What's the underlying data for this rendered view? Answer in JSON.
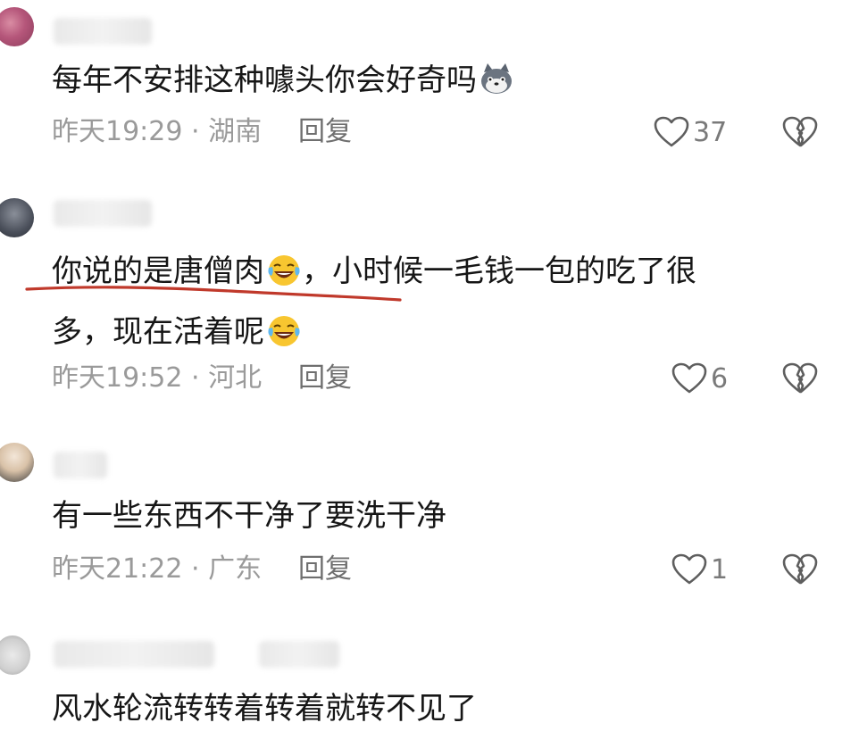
{
  "comments": [
    {
      "text_before": "每年不安排这种噱头你会好奇吗",
      "text_after": "",
      "emoji": "wolf-emoji",
      "time": "昨天19:29",
      "sep": "·",
      "location": "湖南",
      "reply": "回复",
      "likes": "37"
    },
    {
      "line1_highlight": "你说的是唐僧肉",
      "line1_rest": "，小时候一毛钱一包的吃了很",
      "line2": "多，现在活着呢",
      "emoji": "laughing-tears-emoji",
      "time": "昨天19:52",
      "sep": "·",
      "location": "河北",
      "reply": "回复",
      "likes": "6"
    },
    {
      "text_before": "有一些东西不干净了要洗干净",
      "time": "昨天21:22",
      "sep": "·",
      "location": "广东",
      "reply": "回复",
      "likes": "1"
    },
    {
      "text_before": "风水轮流转转着转着就转不见了"
    }
  ],
  "colors": {
    "underline": "#c0392b",
    "meta": "#9a9a9a"
  }
}
